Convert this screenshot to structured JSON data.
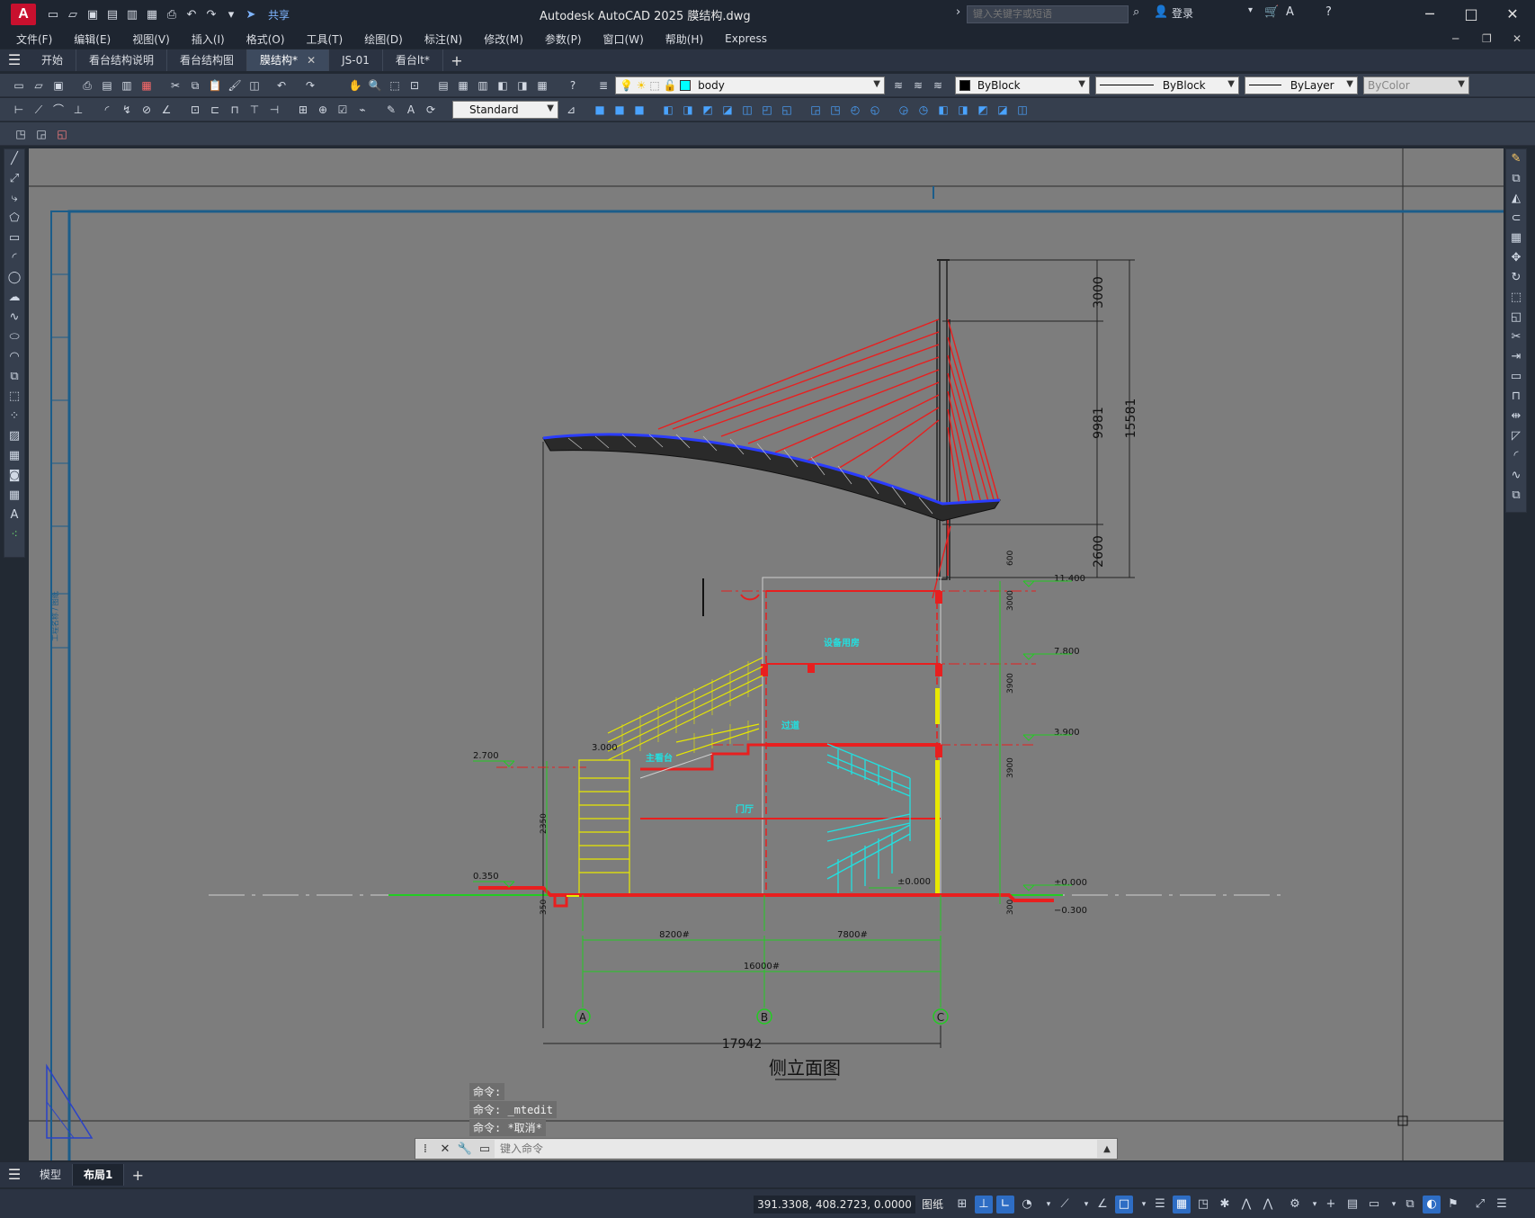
{
  "titlebar": {
    "app_logo": "A",
    "share_label": "共享",
    "title": "Autodesk AutoCAD 2025    膜结构.dwg",
    "search_placeholder": "键入关键字或短语",
    "login_label": "登录"
  },
  "menu": {
    "items": [
      "文件(F)",
      "编辑(E)",
      "视图(V)",
      "插入(I)",
      "格式(O)",
      "工具(T)",
      "绘图(D)",
      "标注(N)",
      "修改(M)",
      "参数(P)",
      "窗口(W)",
      "帮助(H)",
      "Express"
    ]
  },
  "doc_tabs": {
    "items": [
      {
        "label": "开始"
      },
      {
        "label": "看台结构说明"
      },
      {
        "label": "看台结构图"
      },
      {
        "label": "膜结构*",
        "active": true
      },
      {
        "label": "JS-01"
      },
      {
        "label": "看台lt*"
      }
    ]
  },
  "properties": {
    "layer": "body",
    "layer_color": "#00ffff",
    "color": "ByBlock",
    "linetype": "ByBlock",
    "lineweight": "ByLayer",
    "plotstyle": "ByColor",
    "dimstyle": "Standard"
  },
  "drawing": {
    "title": "侧立面图",
    "dims": {
      "top": "3000",
      "mid": "9981",
      "bottom": "2600",
      "total": "15581",
      "span": "17942",
      "ab": "8200#",
      "bc": "7800#",
      "ac": "16000#",
      "h3000": "3000",
      "h3900a": "3900",
      "h3900b": "3900",
      "h600": "600",
      "h2350": "2350",
      "h350": "350",
      "h300": "300"
    },
    "elevations": {
      "e11400": "11.400",
      "e7800": "7.800",
      "e3900": "3.900",
      "e000": "±0.000",
      "em300": "−0.300",
      "e2700": "2.700",
      "e0350": "0.350",
      "e3000": "3.000",
      "e000b": "±0.000"
    },
    "axes": [
      "A",
      "B",
      "C"
    ],
    "room_labels": {
      "equip": "设备用房",
      "aisle": "过道",
      "stand": "主看台",
      "hall": "门厅"
    },
    "frame_text": "工程名称 / 图纸"
  },
  "command": {
    "history": [
      "命令:",
      "命令: _mtedit",
      "命令: *取消*"
    ],
    "placeholder": "键入命令"
  },
  "layout_tabs": {
    "items": [
      {
        "label": "模型"
      },
      {
        "label": "布局1",
        "active": true
      }
    ]
  },
  "status": {
    "coords": "391.3308, 408.2723, 0.0000",
    "paper": "图纸"
  }
}
